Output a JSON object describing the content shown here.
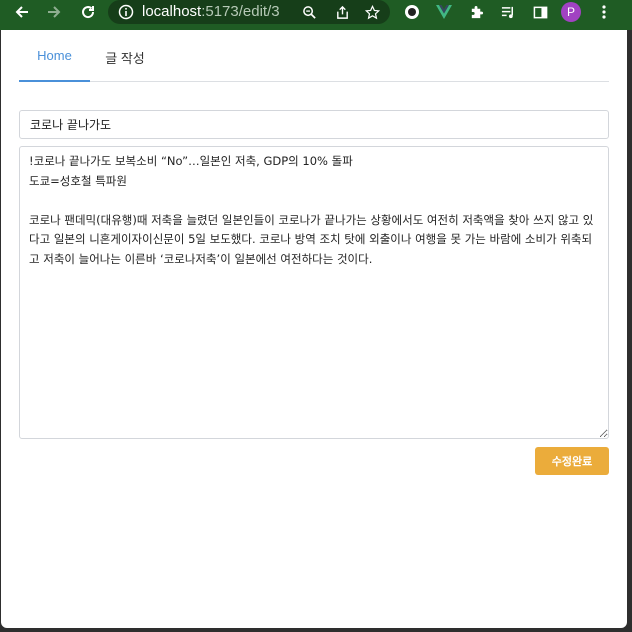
{
  "browser": {
    "url_host": "localhost",
    "url_path": ":5173/edit/3",
    "profile_initial": "P"
  },
  "tabs": [
    {
      "label": "Home",
      "active": true
    },
    {
      "label": "글 작성",
      "active": false
    }
  ],
  "form": {
    "title_value": "코로나 끝나가도",
    "content_value": "!코로나 끝나가도 보복소비 “No”…일본인 저축, GDP의 10% 돌파\n도쿄=성호철 특파원\n\n코로나 팬데믹(대유행)때 저축을 늘렸던 일본인들이 코로나가 끝나가는 상황에서도 여전히 저축액을 찾아 쓰지 않고 있다고 일본의 니혼게이자이신문이 5일 보도했다. 코로나 방역 조치 탓에 외출이나 여행을 못 가는 바람에 소비가 위축되고 저축이 늘어나는 이른바 ‘코로나저축’이 일본에선 여전하다는 것이다.",
    "submit_label": "수정완료"
  },
  "colors": {
    "toolbar_bg": "#1f5c24",
    "accent_tab": "#4a90d9",
    "submit_bg": "#ebac3b"
  }
}
